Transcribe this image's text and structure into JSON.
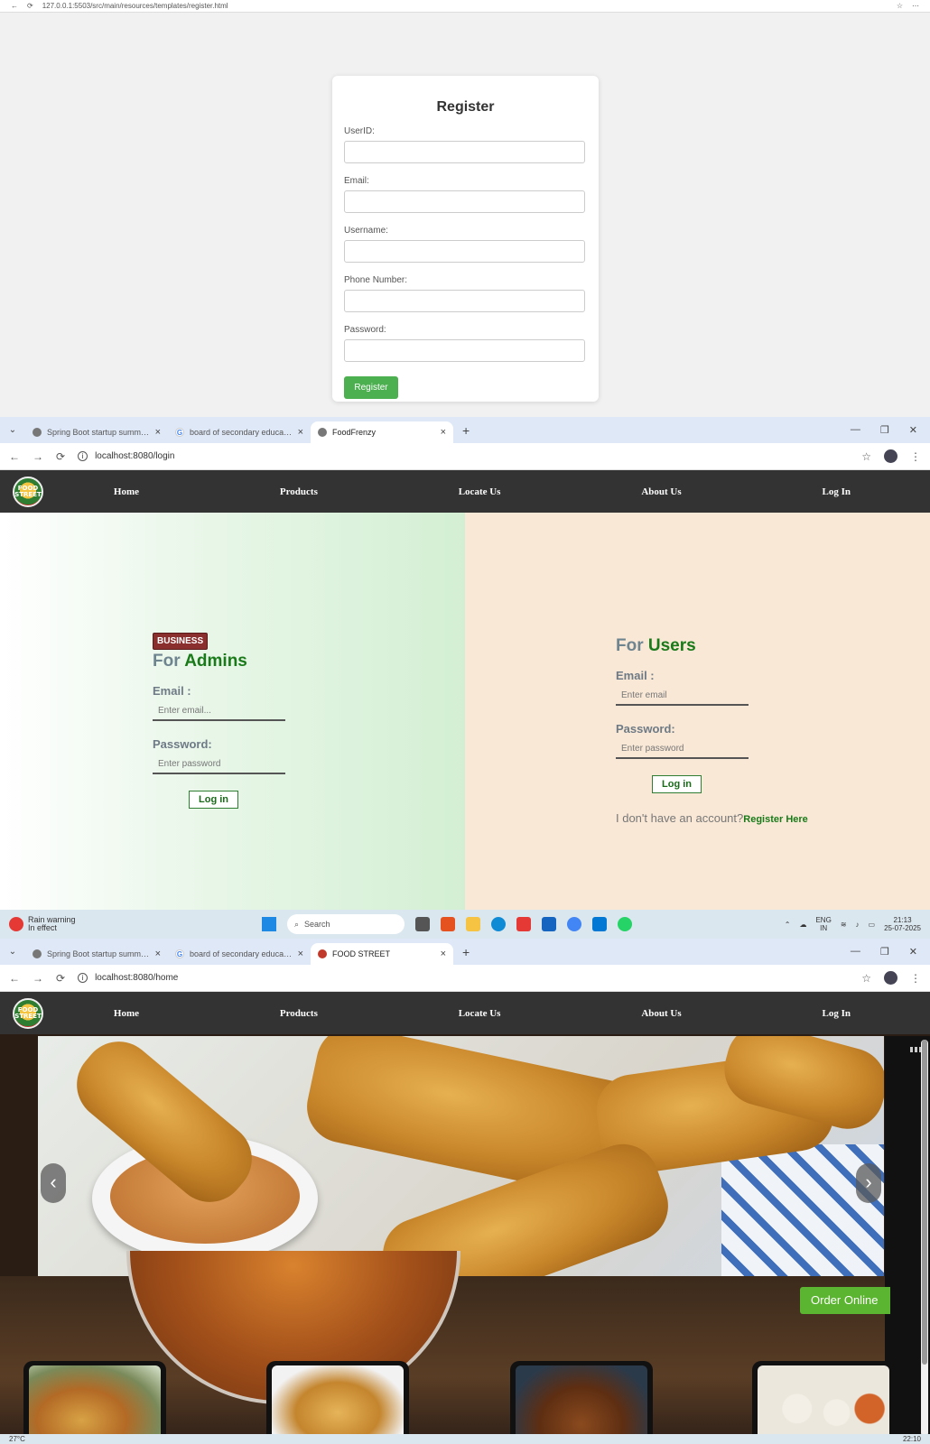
{
  "register_screen": {
    "url": "127.0.0.1:5503/src/main/resources/templates/register.html",
    "title": "Register",
    "fields": [
      {
        "label": "UserID:"
      },
      {
        "label": "Email:"
      },
      {
        "label": "Username:"
      },
      {
        "label": "Phone Number:"
      },
      {
        "label": "Password:"
      }
    ],
    "button": "Register",
    "accent_color": "#4caf50"
  },
  "login_screen": {
    "tabs": [
      {
        "title": "Spring Boot startup summary",
        "icon": "globe-icon"
      },
      {
        "title": "board of secondary education...",
        "icon": "google-icon"
      },
      {
        "title": "FoodFrenzy",
        "icon": "globe-icon"
      }
    ],
    "url": "localhost:8080/login",
    "nav": [
      "Home",
      "Products",
      "Locate Us",
      "About Us",
      "Log In"
    ],
    "logo_text": "FOOD STREET",
    "admin": {
      "badge": "BUSINESS",
      "title_prefix": "For ",
      "title_accent": "Admins",
      "email_label": "Email :",
      "email_placeholder": "Enter email...",
      "password_label": "Password:",
      "password_placeholder": "Enter password",
      "button": "Log in"
    },
    "user": {
      "title_prefix": "For ",
      "title_accent": "Users",
      "email_label": "Email :",
      "email_placeholder": "Enter email",
      "password_label": "Password:",
      "password_placeholder": "Enter password",
      "button": "Log in",
      "no_account": "I don't have an account?",
      "register_link": "Register Here"
    },
    "colors": {
      "nav_bg": "#333333",
      "accent_green": "#1a7a1a",
      "user_panel_bg": "#f9e8d6",
      "badge_bg": "#8b2e2e"
    }
  },
  "taskbar": {
    "weather_title": "Rain warning",
    "weather_sub": "In effect",
    "search": "Search",
    "lang": "ENG",
    "lang_sub": "IN",
    "time": "21:13",
    "date": "25-07-2025"
  },
  "home_screen": {
    "tabs": [
      {
        "title": "Spring Boot startup summary",
        "icon": "globe-icon"
      },
      {
        "title": "board of secondary education...",
        "icon": "google-icon"
      },
      {
        "title": "FOOD STREET",
        "icon": "food-street-icon"
      }
    ],
    "url": "localhost:8080/home",
    "nav": [
      "Home",
      "Products",
      "Locate Us",
      "About Us",
      "Log In"
    ],
    "order_button": "Order Online",
    "carousel_prev": "‹",
    "carousel_next": "›"
  },
  "bottom_taskbar": {
    "temp": "27°C",
    "time": "22:10"
  }
}
